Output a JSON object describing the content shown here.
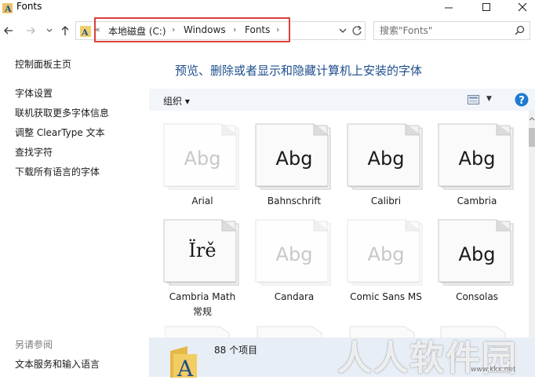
{
  "window": {
    "title": "Fonts"
  },
  "address": {
    "crumbs": [
      "本地磁盘 (C:)",
      "Windows",
      "Fonts"
    ],
    "overflow": "«"
  },
  "search": {
    "placeholder": "搜索\"Fonts\""
  },
  "left_pane": {
    "home": "控制面板主页",
    "links": [
      "字体设置",
      "联机获取更多字体信息",
      "调整 ClearType 文本",
      "查找字符",
      "下载所有语言的字体"
    ],
    "see_also_title": "另请参阅",
    "see_also_links": [
      "文本服务和输入语言"
    ]
  },
  "main": {
    "heading": "预览、删除或者显示和隐藏计算机上安装的字体",
    "organize": "组织 ▾"
  },
  "fonts": [
    {
      "name": "Arial",
      "sample": "Abg",
      "hidden": true
    },
    {
      "name": "Bahnschrift",
      "sample": "Abg",
      "hidden": false
    },
    {
      "name": "Calibri",
      "sample": "Abg",
      "hidden": false
    },
    {
      "name": "Cambria",
      "sample": "Abg",
      "hidden": false
    },
    {
      "name": "Cambria Math",
      "name2": "常规",
      "sample": "Ïrě",
      "hidden": false
    },
    {
      "name": "Candara",
      "sample": "Abg",
      "hidden": true
    },
    {
      "name": "Comic Sans MS",
      "sample": "Abg",
      "hidden": true
    },
    {
      "name": "Consolas",
      "sample": "Abg",
      "hidden": false
    }
  ],
  "status": {
    "count": "88 个项目"
  },
  "watermark": {
    "text": "人人软件园",
    "url": "www.kkx.net"
  },
  "colors": {
    "accent": "#1e4e8c",
    "highlight_box": "#d9403c",
    "help": "#1e7bd2"
  }
}
